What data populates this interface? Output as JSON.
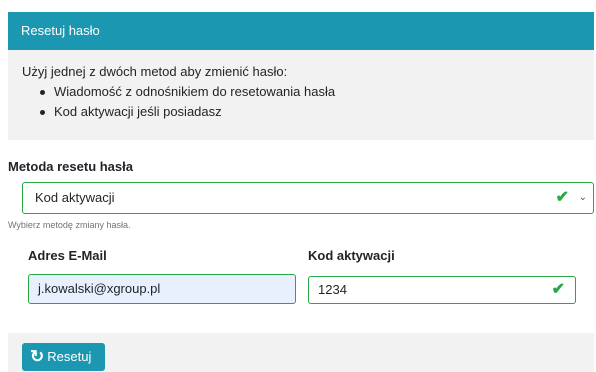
{
  "panel": {
    "title": "Resetuj hasło",
    "intro": "Użyj jednej z dwóch metod aby zmienić hasło:",
    "options": [
      "Wiadomość z odnośnikiem do resetowania hasła",
      "Kod aktywacji jeśli posiadasz"
    ]
  },
  "form": {
    "method_label": "Metoda resetu hasła",
    "method_value": "Kod aktywacji",
    "method_help": "Wybierz metodę zmiany hasła.",
    "email_label": "Adres E-Mail",
    "email_value": "j.kowalski@xgroup.pl",
    "code_label": "Kod aktywacji",
    "code_value": "1234",
    "submit_label": "Resetuj"
  },
  "colors": {
    "accent": "#1c97b1",
    "valid": "#28a745",
    "panel_bg": "#f2f2f2",
    "autofill_bg": "#e8f0fe"
  },
  "icons": {
    "valid": "check-icon",
    "dropdown": "chevron-down-icon",
    "submit": "refresh-icon"
  }
}
